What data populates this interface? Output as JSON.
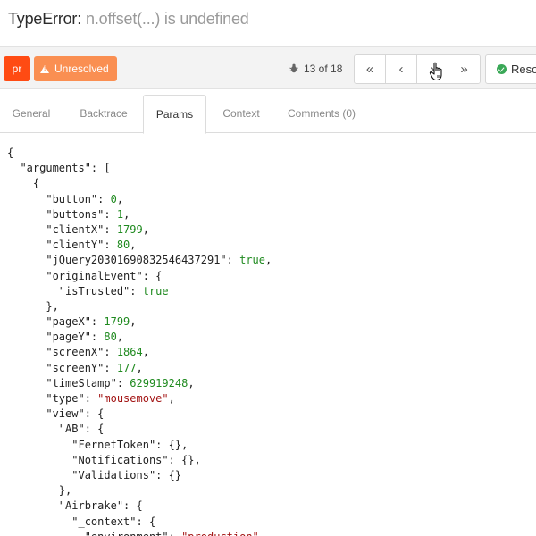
{
  "error": {
    "type": "TypeError:",
    "message": "n.offset(...) is undefined"
  },
  "toolbar": {
    "env_badge": "pr",
    "status_label": "Unresolved",
    "counter": "13 of 18",
    "resolve_label": "Reso",
    "nav": [
      "first",
      "previous",
      "next",
      "last"
    ]
  },
  "tabs": [
    "General",
    "Backtrace",
    "Params",
    "Context",
    "Comments (0)"
  ],
  "active_tab": "Params",
  "colors": {
    "env_badge": "#ff4b13",
    "status": "#fa8f52",
    "resolve_check": "#3aa857",
    "number": "#1f8a1f",
    "string": "#a31515"
  },
  "code_lines": [
    [
      [
        "p",
        "{"
      ]
    ],
    [
      [
        "p",
        "  \"arguments\": ["
      ]
    ],
    [
      [
        "p",
        "    {"
      ]
    ],
    [
      [
        "p",
        "      \"button\": "
      ],
      [
        "n",
        "0"
      ],
      [
        "p",
        ","
      ]
    ],
    [
      [
        "p",
        "      \"buttons\": "
      ],
      [
        "n",
        "1"
      ],
      [
        "p",
        ","
      ]
    ],
    [
      [
        "p",
        "      \"clientX\": "
      ],
      [
        "n",
        "1799"
      ],
      [
        "p",
        ","
      ]
    ],
    [
      [
        "p",
        "      \"clientY\": "
      ],
      [
        "n",
        "80"
      ],
      [
        "p",
        ","
      ]
    ],
    [
      [
        "p",
        "      \"jQuery20301690832546437291\": "
      ],
      [
        "b",
        "true"
      ],
      [
        "p",
        ","
      ]
    ],
    [
      [
        "p",
        "      \"originalEvent\": {"
      ]
    ],
    [
      [
        "p",
        "        \"isTrusted\": "
      ],
      [
        "b",
        "true"
      ]
    ],
    [
      [
        "p",
        "      },"
      ]
    ],
    [
      [
        "p",
        "      \"pageX\": "
      ],
      [
        "n",
        "1799"
      ],
      [
        "p",
        ","
      ]
    ],
    [
      [
        "p",
        "      \"pageY\": "
      ],
      [
        "n",
        "80"
      ],
      [
        "p",
        ","
      ]
    ],
    [
      [
        "p",
        "      \"screenX\": "
      ],
      [
        "n",
        "1864"
      ],
      [
        "p",
        ","
      ]
    ],
    [
      [
        "p",
        "      \"screenY\": "
      ],
      [
        "n",
        "177"
      ],
      [
        "p",
        ","
      ]
    ],
    [
      [
        "p",
        "      \"timeStamp\": "
      ],
      [
        "n",
        "629919248"
      ],
      [
        "p",
        ","
      ]
    ],
    [
      [
        "p",
        "      \"type\": "
      ],
      [
        "s",
        "\"mousemove\""
      ],
      [
        "p",
        ","
      ]
    ],
    [
      [
        "p",
        "      \"view\": {"
      ]
    ],
    [
      [
        "p",
        "        \"AB\": {"
      ]
    ],
    [
      [
        "p",
        "          \"FernetToken\": {},"
      ]
    ],
    [
      [
        "p",
        "          \"Notifications\": {},"
      ]
    ],
    [
      [
        "p",
        "          \"Validations\": {}"
      ]
    ],
    [
      [
        "p",
        "        },"
      ]
    ],
    [
      [
        "p",
        "        \"Airbrake\": {"
      ]
    ],
    [
      [
        "p",
        "          \"_context\": {"
      ]
    ],
    [
      [
        "p",
        "            \"environment\": "
      ],
      [
        "s",
        "\"production\""
      ]
    ]
  ]
}
